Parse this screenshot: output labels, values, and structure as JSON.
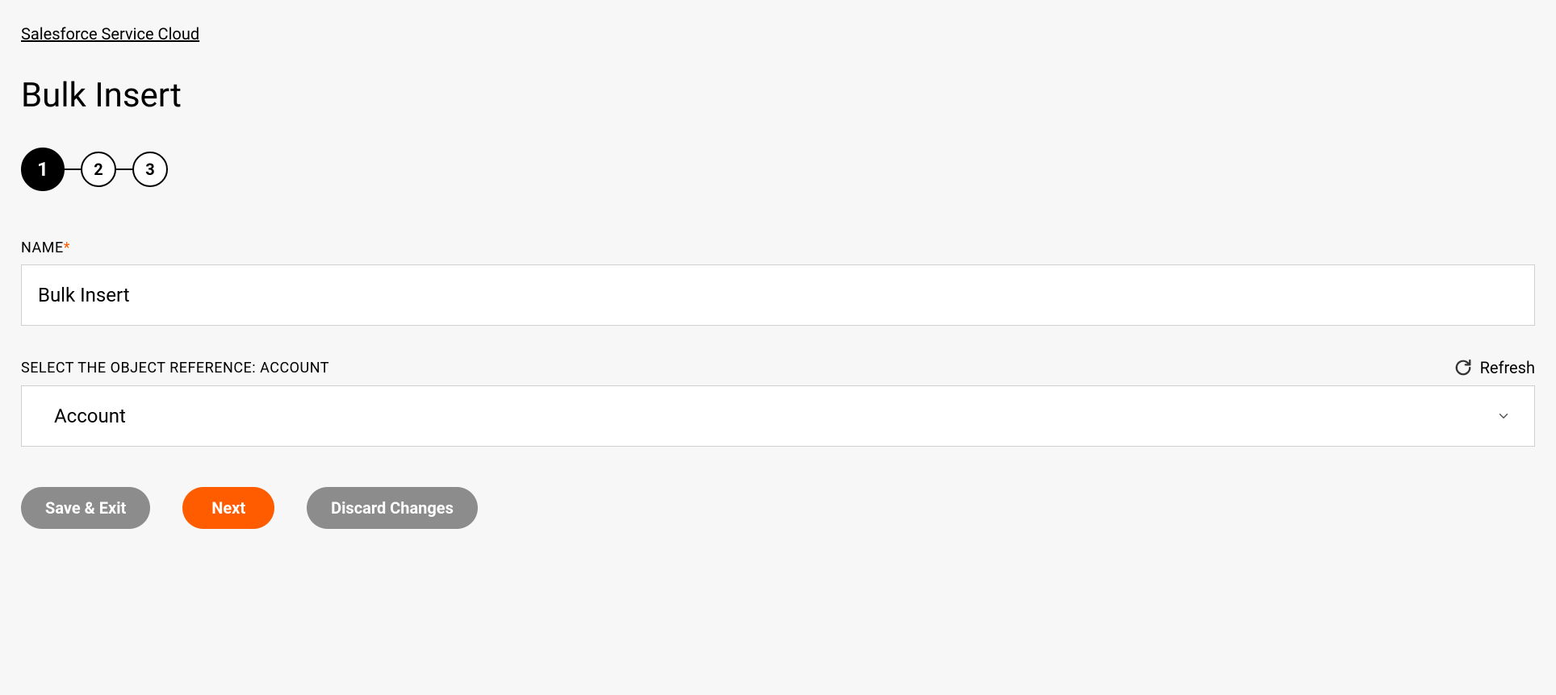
{
  "breadcrumb": "Salesforce Service Cloud",
  "page_title": "Bulk Insert",
  "stepper": {
    "steps": [
      "1",
      "2",
      "3"
    ],
    "active_index": 0
  },
  "form": {
    "name_label": "NAME",
    "required_marker": "*",
    "name_value": "Bulk Insert",
    "object_ref_label": "SELECT THE OBJECT REFERENCE: ACCOUNT",
    "object_ref_value": "Account",
    "refresh_label": "Refresh"
  },
  "buttons": {
    "save_exit": "Save & Exit",
    "next": "Next",
    "discard": "Discard Changes"
  }
}
